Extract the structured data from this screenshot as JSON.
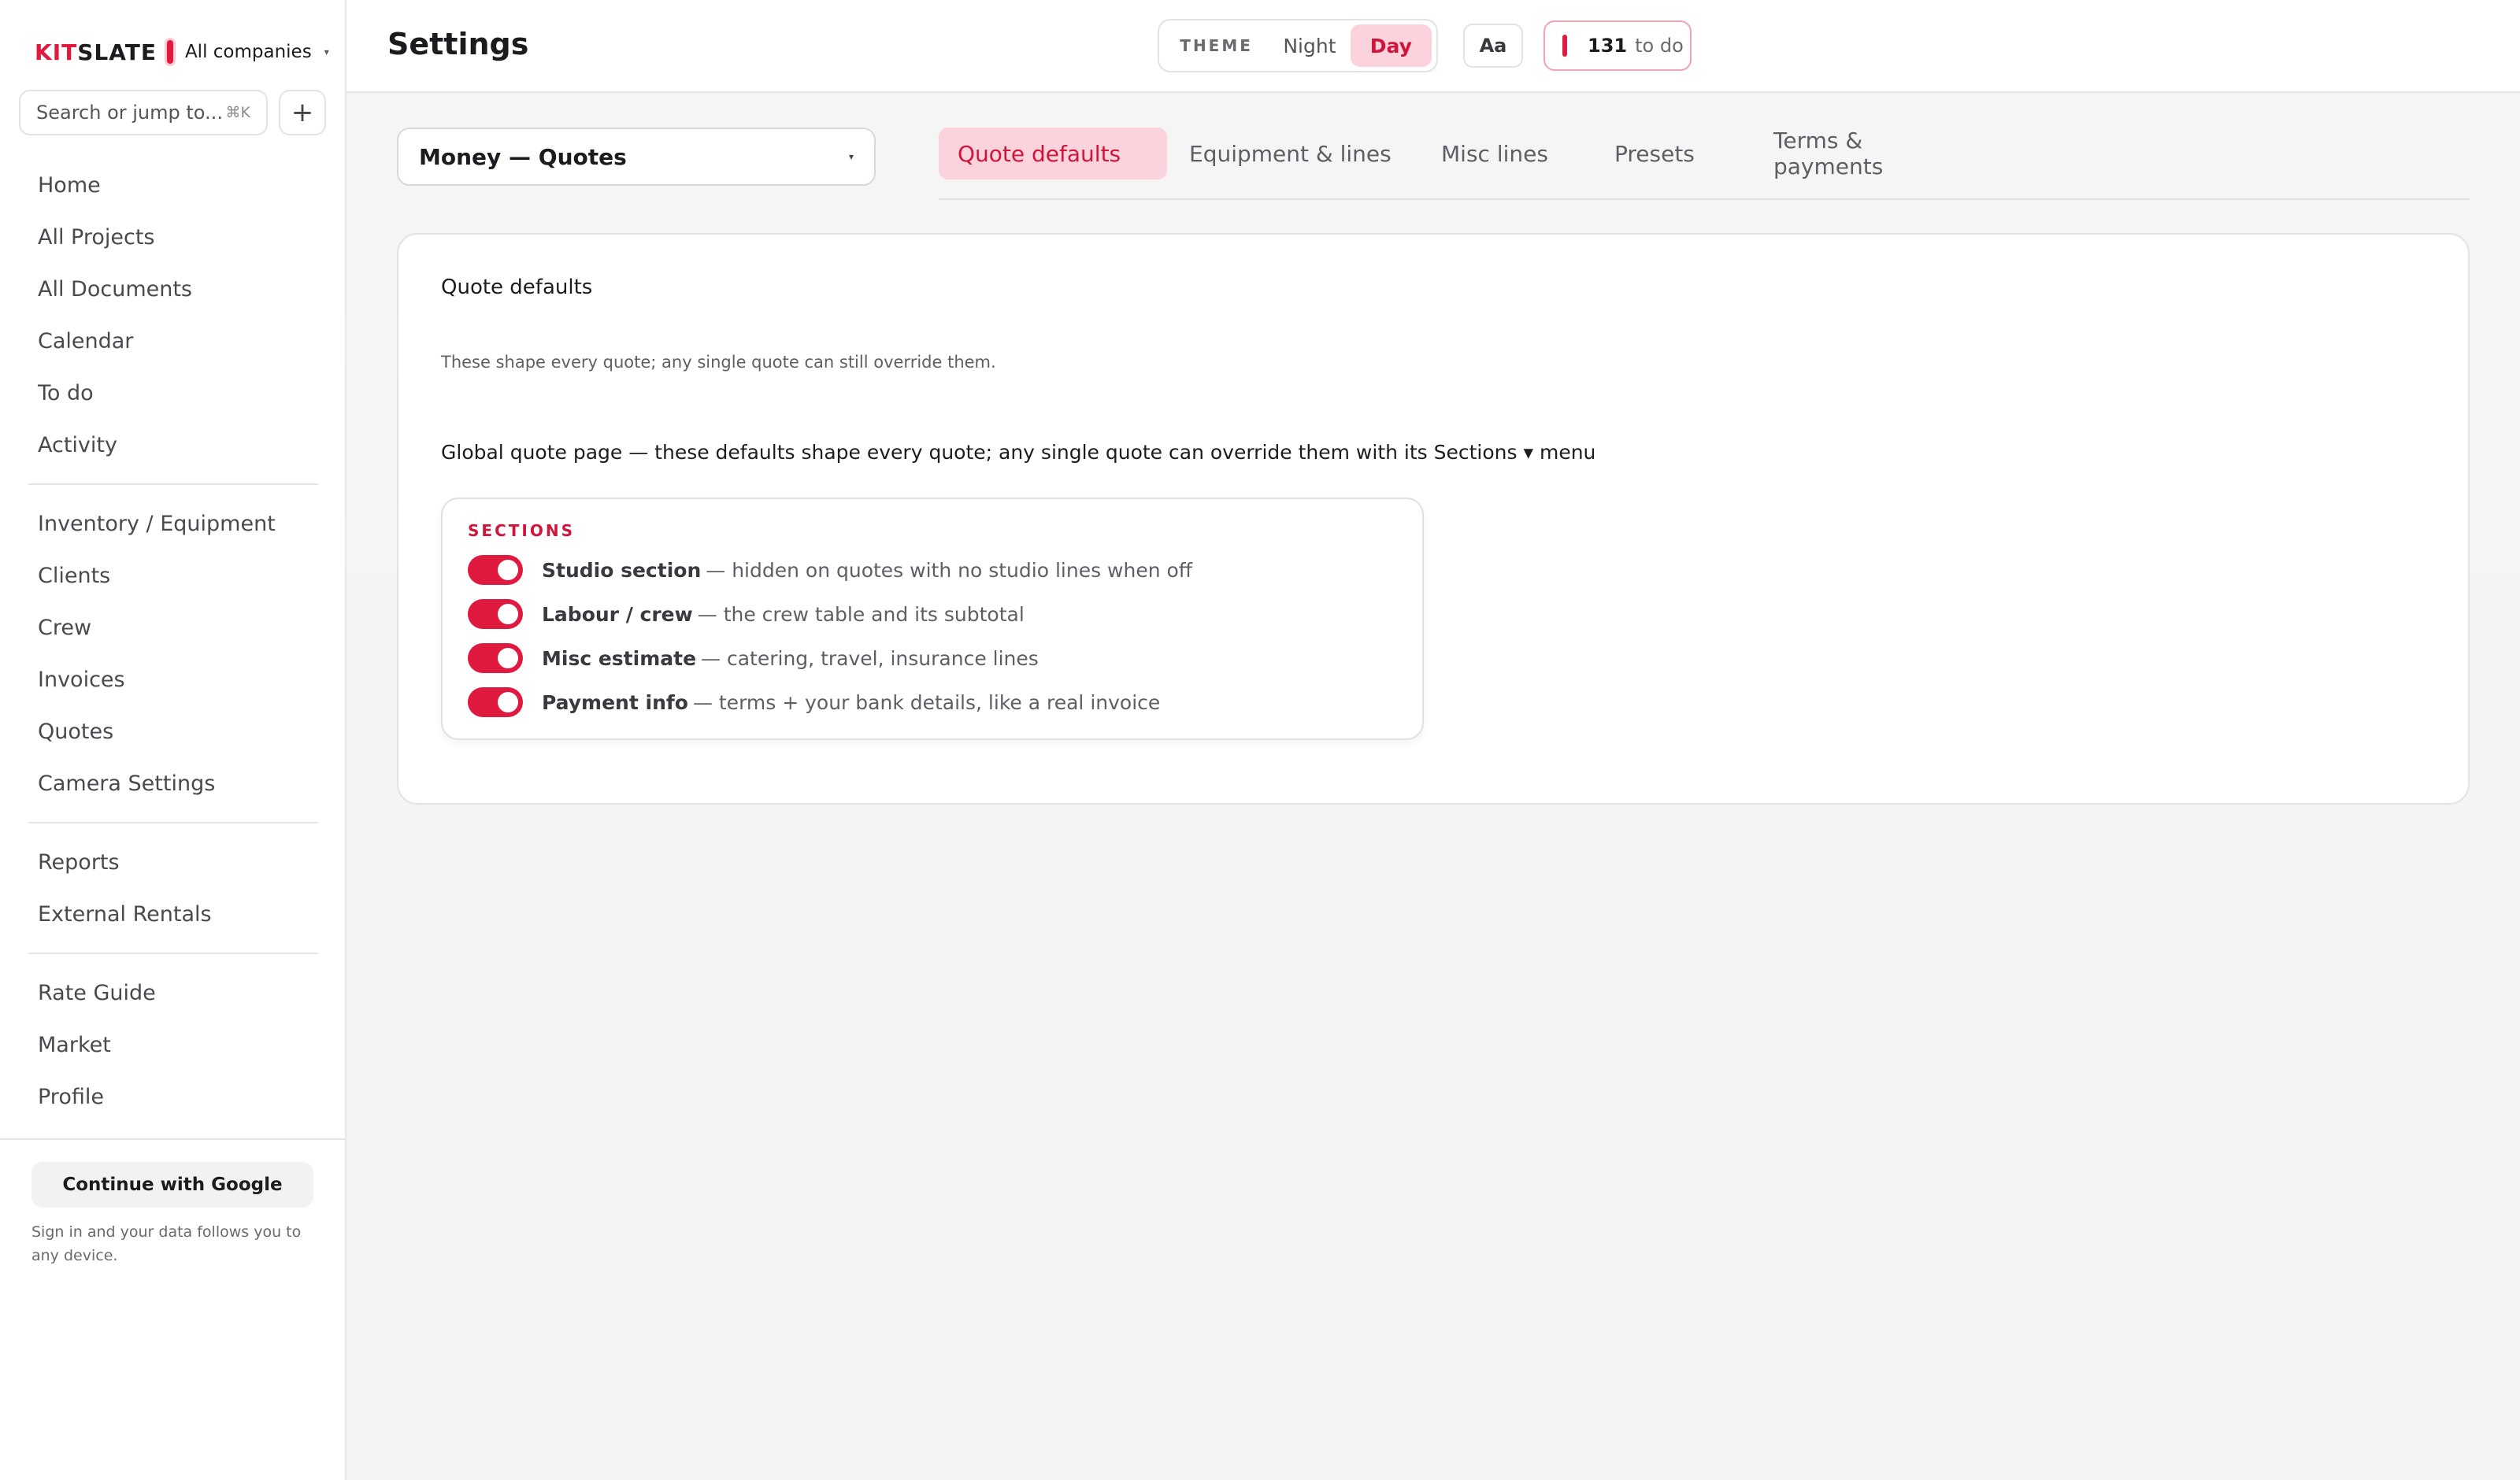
{
  "sidebar": {
    "brand_prefix": "KIT",
    "brand_suffix": "SLATE",
    "company": "All companies",
    "search": {
      "placeholder": "Search or jump to...",
      "shortcut": "⌘K"
    },
    "add_label": "+",
    "groups": [
      [
        "Home",
        "All Projects",
        "All Documents",
        "Calendar",
        "To do",
        "Activity"
      ],
      [
        "Inventory / Equipment",
        "Clients",
        "Crew",
        "Invoices",
        "Quotes",
        "Camera Settings"
      ],
      [
        "Reports",
        "External Rentals"
      ],
      [
        "Rate Guide",
        "Market",
        "Profile"
      ]
    ],
    "google_button": "Continue with Google",
    "signin_note": "Sign in and your data follows you to any device."
  },
  "header": {
    "title": "Settings",
    "theme_label": "THEME",
    "theme_options": [
      "Night",
      "Day"
    ],
    "theme_active": "Day",
    "font_button": "Aa",
    "todo_count": "131",
    "todo_label": "to do"
  },
  "settings": {
    "section_select": "Money — Quotes",
    "tabs": [
      "Quote defaults",
      "Equipment & lines",
      "Misc lines",
      "Presets",
      "Terms & payments"
    ],
    "active_tab": "Quote defaults"
  },
  "card": {
    "title": "Quote defaults",
    "description": "These shape every quote; any single quote can still override them.",
    "global_note": "Global quote page — these defaults shape every quote; any single quote can override them with its Sections ▾ menu",
    "sections_label": "SECTIONS",
    "toggles": [
      {
        "name": "Studio section",
        "desc": "— hidden on quotes with no studio lines when off",
        "on": true
      },
      {
        "name": "Labour / crew",
        "desc": "— the crew table and its subtotal",
        "on": true
      },
      {
        "name": "Misc estimate",
        "desc": "— catering, travel, insurance lines",
        "on": true
      },
      {
        "name": "Payment info",
        "desc": "— terms + your bank details, like a real invoice",
        "on": true
      }
    ]
  },
  "colors": {
    "accent": "#e0193f",
    "accent_soft": "#fbd3dc",
    "background": "#f4f3f4"
  }
}
